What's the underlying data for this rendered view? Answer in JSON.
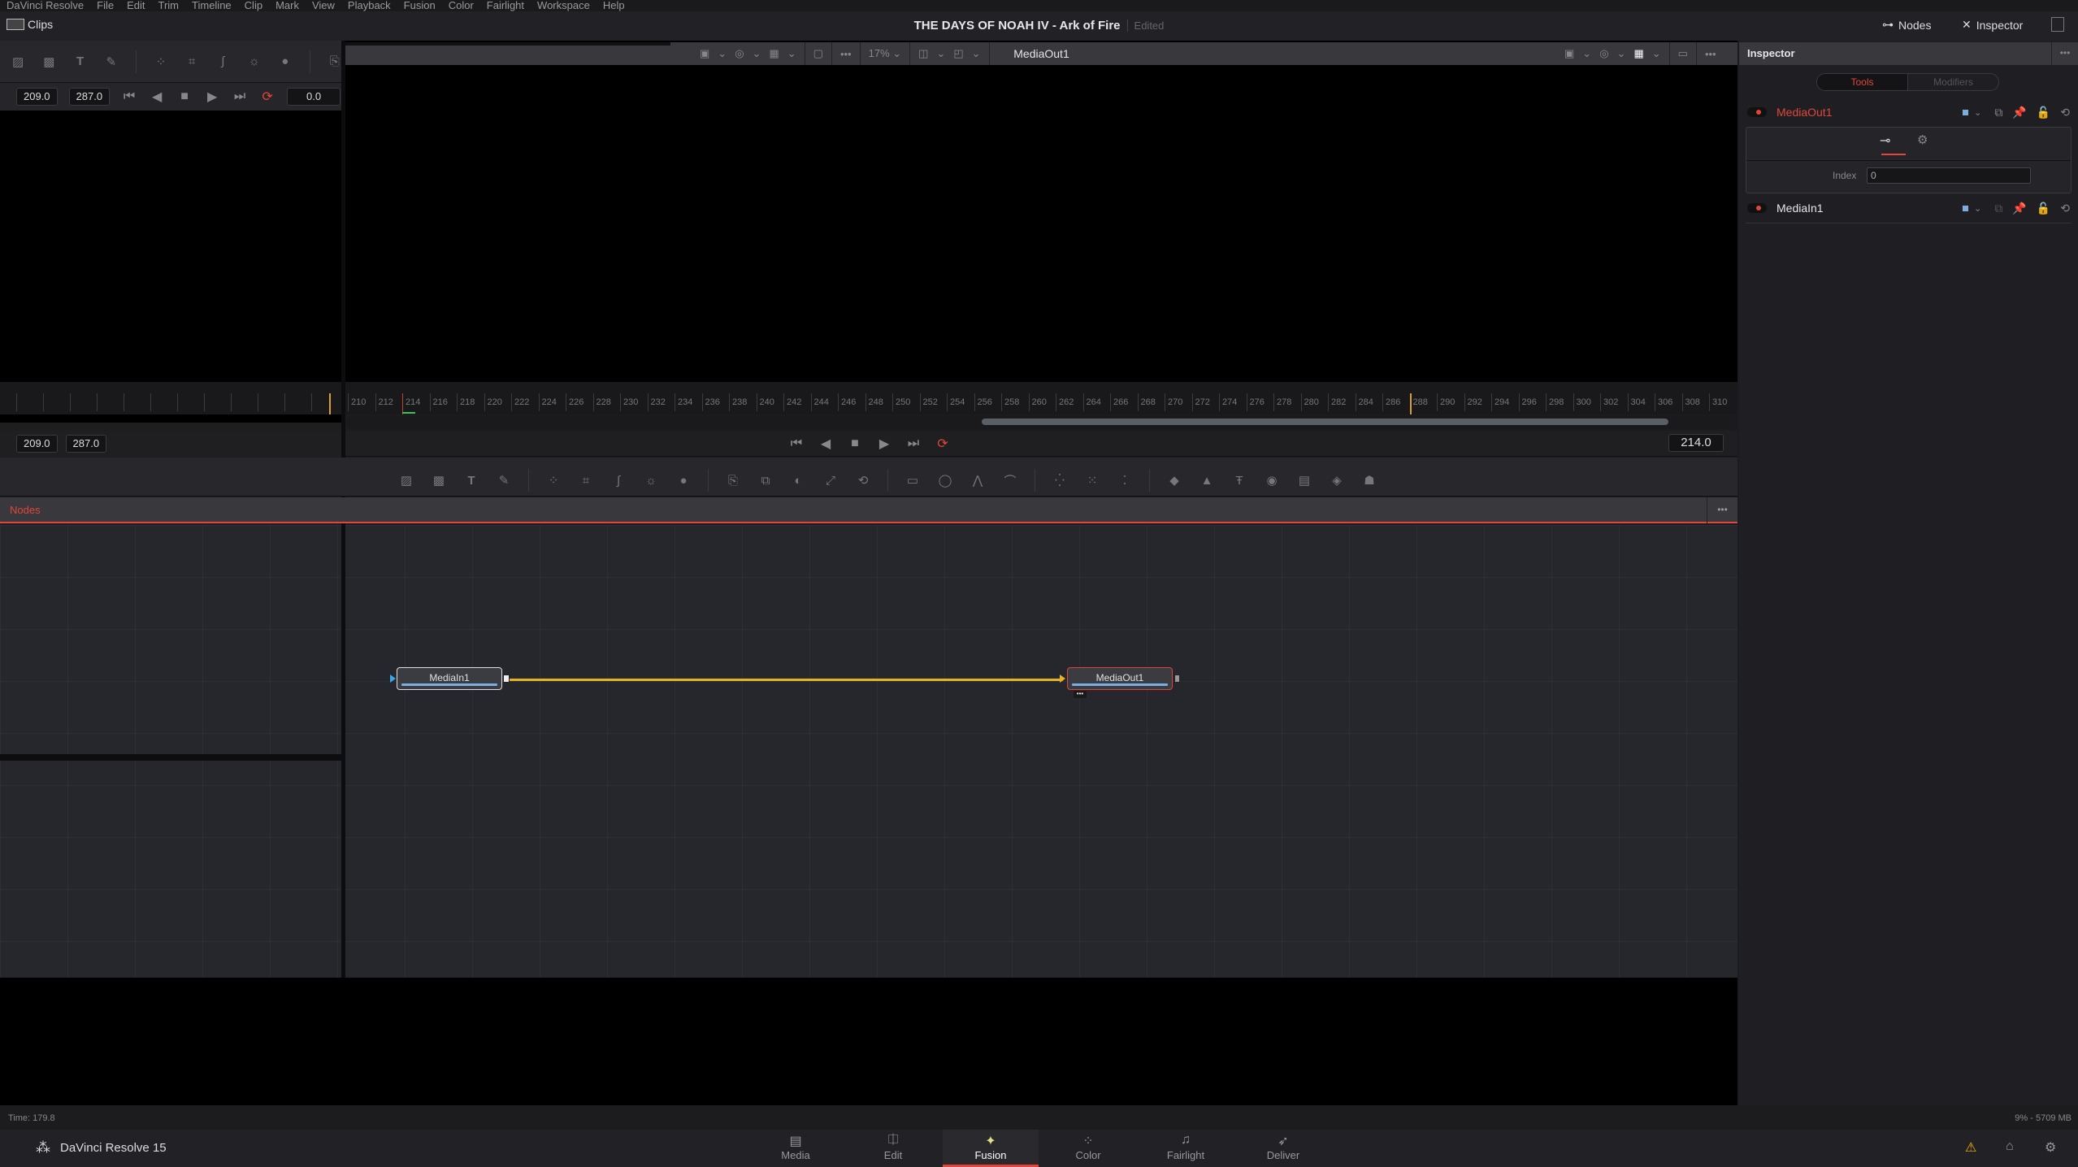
{
  "menubar": {
    "items": [
      "DaVinci Resolve",
      "File",
      "Edit",
      "Trim",
      "Timeline",
      "Clip",
      "Mark",
      "View",
      "Playback",
      "Fusion",
      "Color",
      "Fairlight",
      "Workspace",
      "Help"
    ]
  },
  "header": {
    "clips_label": "Clips",
    "project_title": "THE DAYS OF NOAH IV - Ark of Fire",
    "status": "Edited",
    "nodes_button": "Nodes",
    "inspector_button": "Inspector"
  },
  "left_viewer": {
    "in": "209.0",
    "out": "287.0",
    "current": "0.0"
  },
  "viewer": {
    "title": "MediaOut1",
    "zoom": "17%"
  },
  "ruler": {
    "ticks": [
      "210",
      "212",
      "214",
      "216",
      "218",
      "220",
      "222",
      "224",
      "226",
      "228",
      "230",
      "232",
      "234",
      "236",
      "238",
      "240",
      "242",
      "244",
      "246",
      "248",
      "250",
      "252",
      "254",
      "256",
      "258",
      "260",
      "262",
      "264",
      "266",
      "268",
      "270",
      "272",
      "274",
      "276",
      "278",
      "280",
      "282",
      "284",
      "286",
      "288",
      "290",
      "292",
      "294",
      "296",
      "298",
      "300",
      "302",
      "304",
      "306",
      "308",
      "310"
    ],
    "playhead": "214",
    "out_marker": "288"
  },
  "transport": {
    "in": "209.0",
    "out": "287.0",
    "current_frame": "214.0"
  },
  "nodes_panel": {
    "title": "Nodes"
  },
  "nodes": [
    {
      "name": "MediaIn1",
      "selected": false
    },
    {
      "name": "MediaOut1",
      "selected": true
    }
  ],
  "inspector": {
    "title": "Inspector",
    "tabs": [
      "Tools",
      "Modifiers"
    ],
    "active_tab": "Tools",
    "tools": [
      {
        "name": "MediaOut1",
        "active": true,
        "color": "#e2463a"
      },
      {
        "name": "MediaIn1",
        "active": false,
        "color": "#e6e6e6"
      }
    ],
    "index_label": "Index",
    "index_value": "0"
  },
  "status": {
    "time": "Time: 179.8",
    "memory": "9% - 5709 MB"
  },
  "bottom": {
    "app_name": "DaVinci Resolve 15",
    "pages": [
      {
        "label": "Media",
        "icon": "media-icon"
      },
      {
        "label": "Edit",
        "icon": "edit-icon"
      },
      {
        "label": "Fusion",
        "icon": "fusion-icon",
        "active": true
      },
      {
        "label": "Color",
        "icon": "color-icon"
      },
      {
        "label": "Fairlight",
        "icon": "fairlight-icon"
      },
      {
        "label": "Deliver",
        "icon": "deliver-icon"
      }
    ]
  },
  "colors": {
    "accent": "#e2463a",
    "link": "#e6b422",
    "node_bar": "#7aaee0",
    "warning": "#f0b400"
  }
}
